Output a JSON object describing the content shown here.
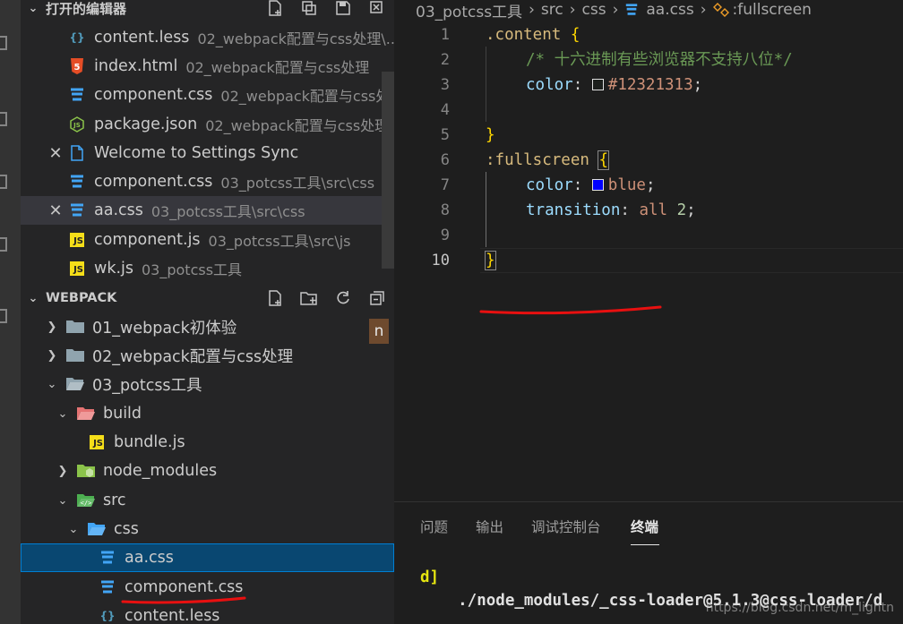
{
  "colors": {
    "accent_blue": "#519aba",
    "red_annotation": "#e81010",
    "selection": "#094771",
    "json_green": "#8bc34a",
    "html_orange": "#e44d26"
  },
  "open_editors": {
    "title": "打开的编辑器",
    "items": [
      {
        "name": "content.less",
        "desc": "02_webpack配置与css处理\\...",
        "icon": "less-icon",
        "glyph": "{}"
      },
      {
        "name": "index.html",
        "desc": "02_webpack配置与css处理",
        "icon": "html-icon",
        "glyph": "5"
      },
      {
        "name": "component.css",
        "desc": "02_webpack配置与css处...",
        "icon": "css-icon",
        "glyph": "3"
      },
      {
        "name": "package.json",
        "desc": "02_webpack配置与css处理",
        "icon": "json-icon",
        "glyph": "JS"
      },
      {
        "name": "Welcome to Settings Sync",
        "desc": "",
        "icon": "file-icon",
        "glyph": ""
      },
      {
        "name": "component.css",
        "desc": "03_potcss工具\\src\\css",
        "icon": "css-icon",
        "glyph": "3"
      },
      {
        "name": "aa.css",
        "desc": "03_potcss工具\\src\\css",
        "icon": "css-icon",
        "glyph": "3"
      },
      {
        "name": "component.js",
        "desc": "03_potcss工具\\src\\js",
        "icon": "js-icon",
        "glyph": "JS"
      },
      {
        "name": "wk.js",
        "desc": "03_potcss工具",
        "icon": "js-icon",
        "glyph": "JS"
      }
    ]
  },
  "workspace": {
    "title": "WEBPACK",
    "badge": "n",
    "tree": [
      {
        "name": "01_webpack初体验",
        "type": "folder",
        "expanded": false
      },
      {
        "name": "02_webpack配置与css处理",
        "type": "folder",
        "expanded": false
      },
      {
        "name": "03_potcss工具",
        "type": "folder",
        "expanded": true
      },
      {
        "name": "build",
        "type": "folder",
        "expanded": true
      },
      {
        "name": "bundle.js",
        "type": "file"
      },
      {
        "name": "node_modules",
        "type": "folder",
        "expanded": false
      },
      {
        "name": "src",
        "type": "folder",
        "expanded": true
      },
      {
        "name": "css",
        "type": "folder",
        "expanded": true
      },
      {
        "name": "aa.css",
        "type": "file"
      },
      {
        "name": "component.css",
        "type": "file"
      },
      {
        "name": "content.less",
        "type": "file"
      }
    ]
  },
  "breadcrumb": {
    "items": [
      "03_potcss工具",
      "src",
      "css",
      "aa.css",
      ":fullscreen"
    ]
  },
  "editor": {
    "line_numbers": [
      "1",
      "2",
      "3",
      "4",
      "5",
      "6",
      "7",
      "8",
      "9",
      "10"
    ],
    "code": {
      "l1_selector": ".content",
      "l1_brace": "{",
      "l2_comment": "/* 十六进制有些浏览器不支持八位*/",
      "l3_prop": "color",
      "l3_colon": ":",
      "l3_value": "#12321313",
      "l3_semi": ";",
      "l5_brace": "}",
      "l6_selector": ":fullscreen",
      "l6_brace": "{",
      "l7_prop": "color",
      "l7_colon": ":",
      "l7_value": "blue",
      "l7_semi": ";",
      "l8_prop": "transition",
      "l8_colon": ":",
      "l8_value": "all",
      "l8_num": "2",
      "l8_semi": ";",
      "l10_brace": "}"
    },
    "swatch_colors": [
      "#12321313",
      "#0000ff"
    ]
  },
  "panel": {
    "tabs": [
      "问题",
      "输出",
      "调试控制台",
      "终端"
    ],
    "active_tab": "终端",
    "terminal_lines": [
      "d]",
      "    ./node_modules/_css-loader@5.1.3@css-loader/d"
    ]
  },
  "watermark": "https://blog.csdn.net/m_lightn"
}
